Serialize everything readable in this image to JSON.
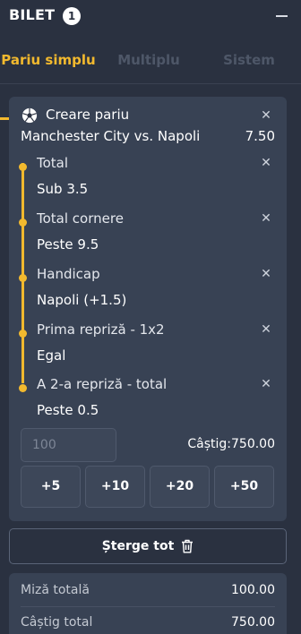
{
  "header": {
    "title": "BILET",
    "badge_count": "1",
    "minimize_icon": "minus-icon"
  },
  "tabs": [
    {
      "label": "Pariu simplu",
      "active": true
    },
    {
      "label": "Multiplu",
      "active": false
    },
    {
      "label": "Sistem",
      "active": false
    }
  ],
  "bet": {
    "icon": "soccer-ball-icon",
    "title": "Creare pariu",
    "match": "Manchester City vs. Napoli",
    "odds": "7.50",
    "remove_icon": "close-icon",
    "selections": [
      {
        "market": "Total",
        "pick": "Sub 3.5"
      },
      {
        "market": "Total cornere",
        "pick": "Peste 9.5"
      },
      {
        "market": "Handicap",
        "pick": "Napoli (+1.5)"
      },
      {
        "market": "Prima repriză - 1x2",
        "pick": "Egal"
      },
      {
        "market": "A 2-a repriză - total",
        "pick": "Peste 0.5"
      }
    ],
    "stake_placeholder": "100",
    "win_label": "Câștig:",
    "win_value": "750.00",
    "quick_stakes": [
      "+5",
      "+10",
      "+20",
      "+50"
    ]
  },
  "clear_all": {
    "label": "Șterge tot",
    "icon": "trash-icon"
  },
  "summary": {
    "total_stake_label": "Miză totală",
    "total_stake_value": "100.00",
    "total_win_label": "Câștig total",
    "total_win_value": "750.00"
  },
  "colors": {
    "accent": "#f2b92e",
    "background": "#2a3140",
    "card": "#384254"
  }
}
